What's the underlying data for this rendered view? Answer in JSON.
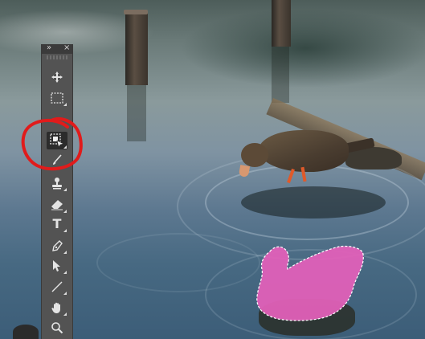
{
  "toolbar": {
    "collapse_glyph": "»",
    "close_glyph": "×",
    "tools": [
      {
        "name": "move-tool",
        "icon": "move-icon"
      },
      {
        "name": "rectangular-marquee-tool",
        "icon": "marquee-icon"
      },
      {
        "name": "object-selection-tool",
        "icon": "object-selection-icon",
        "active": true
      },
      {
        "name": "brush-tool",
        "icon": "brush-icon"
      },
      {
        "name": "clone-stamp-tool",
        "icon": "stamp-icon"
      },
      {
        "name": "eraser-tool",
        "icon": "eraser-icon"
      },
      {
        "name": "type-tool",
        "icon": "type-icon",
        "letter": "T"
      },
      {
        "name": "pen-tool",
        "icon": "pen-icon"
      },
      {
        "name": "path-selection-tool",
        "icon": "arrow-icon"
      },
      {
        "name": "line-tool",
        "icon": "line-icon"
      },
      {
        "name": "hand-tool",
        "icon": "hand-icon"
      },
      {
        "name": "zoom-tool",
        "icon": "magnifier-icon"
      }
    ]
  },
  "selection": {
    "fill_color": "#e060b8",
    "outline": "marching-ants"
  },
  "annotation": {
    "color": "#e11b1b",
    "shape": "hand-drawn-circle"
  }
}
